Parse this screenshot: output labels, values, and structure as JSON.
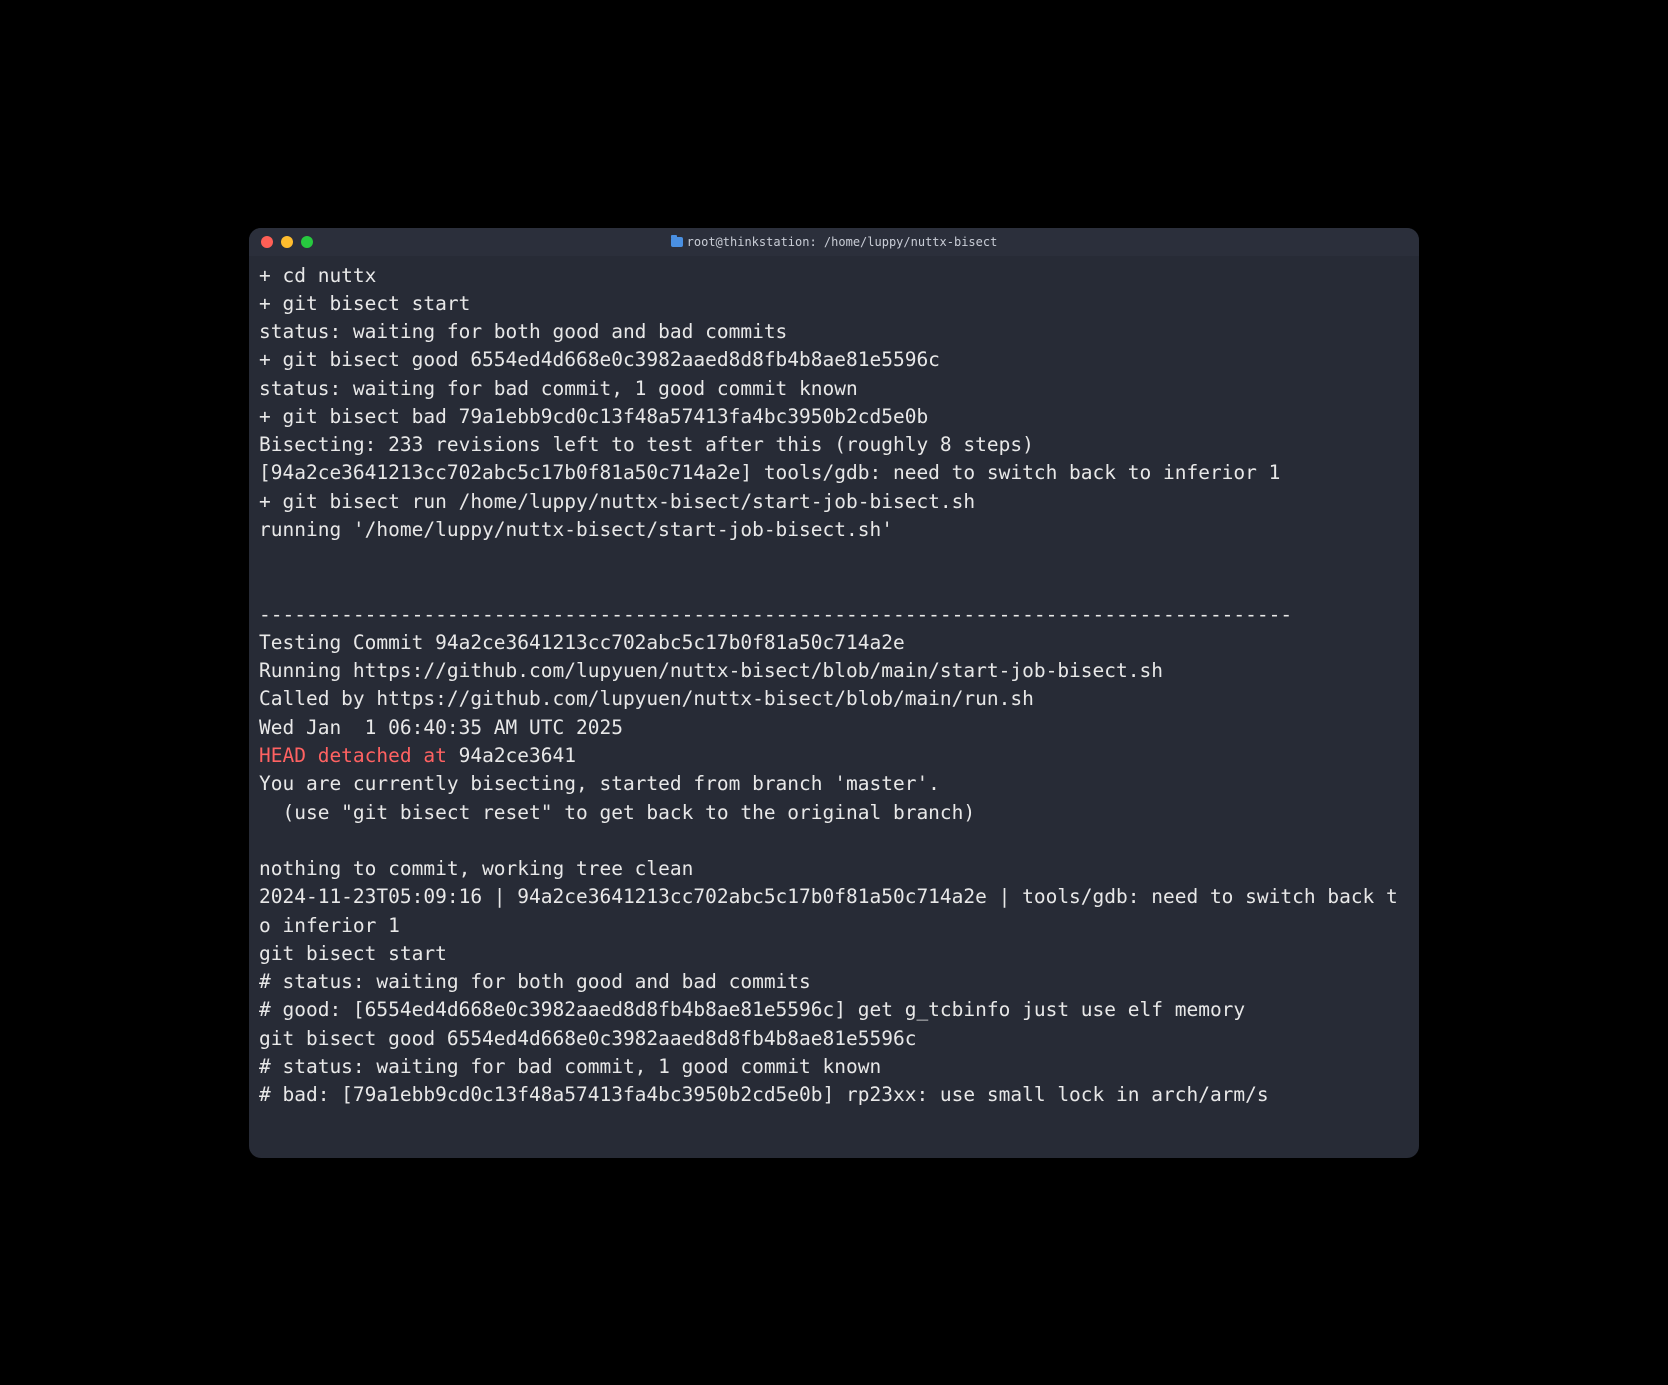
{
  "window": {
    "title": "root@thinkstation: /home/luppy/nuttx-bisect"
  },
  "terminal": {
    "lines": [
      {
        "t": "+ cd nuttx"
      },
      {
        "t": "+ git bisect start"
      },
      {
        "t": "status: waiting for both good and bad commits"
      },
      {
        "t": "+ git bisect good 6554ed4d668e0c3982aaed8d8fb4b8ae81e5596c"
      },
      {
        "t": "status: waiting for bad commit, 1 good commit known"
      },
      {
        "t": "+ git bisect bad 79a1ebb9cd0c13f48a57413fa4bc3950b2cd5e0b"
      },
      {
        "t": "Bisecting: 233 revisions left to test after this (roughly 8 steps)"
      },
      {
        "t": "[94a2ce3641213cc702abc5c17b0f81a50c714a2e] tools/gdb: need to switch back to inferior 1"
      },
      {
        "t": "+ git bisect run /home/luppy/nuttx-bisect/start-job-bisect.sh"
      },
      {
        "t": "running '/home/luppy/nuttx-bisect/start-job-bisect.sh'"
      },
      {
        "t": ""
      },
      {
        "t": ""
      },
      {
        "t": "----------------------------------------------------------------------------------------"
      },
      {
        "t": "Testing Commit 94a2ce3641213cc702abc5c17b0f81a50c714a2e"
      },
      {
        "t": "Running https://github.com/lupyuen/nuttx-bisect/blob/main/start-job-bisect.sh"
      },
      {
        "t": "Called by https://github.com/lupyuen/nuttx-bisect/blob/main/run.sh"
      },
      {
        "t": "Wed Jan  1 06:40:35 AM UTC 2025"
      },
      {
        "red": "HEAD detached at ",
        "rest": "94a2ce3641"
      },
      {
        "t": "You are currently bisecting, started from branch 'master'."
      },
      {
        "t": "  (use \"git bisect reset\" to get back to the original branch)"
      },
      {
        "t": ""
      },
      {
        "t": "nothing to commit, working tree clean"
      },
      {
        "t": "2024-11-23T05:09:16 | 94a2ce3641213cc702abc5c17b0f81a50c714a2e | tools/gdb: need to switch back to inferior 1"
      },
      {
        "t": "git bisect start"
      },
      {
        "t": "# status: waiting for both good and bad commits"
      },
      {
        "t": "# good: [6554ed4d668e0c3982aaed8d8fb4b8ae81e5596c] get g_tcbinfo just use elf memory"
      },
      {
        "t": "git bisect good 6554ed4d668e0c3982aaed8d8fb4b8ae81e5596c"
      },
      {
        "t": "# status: waiting for bad commit, 1 good commit known"
      },
      {
        "t": "# bad: [79a1ebb9cd0c13f48a57413fa4bc3950b2cd5e0b] rp23xx: use small lock in arch/arm/s"
      }
    ]
  }
}
